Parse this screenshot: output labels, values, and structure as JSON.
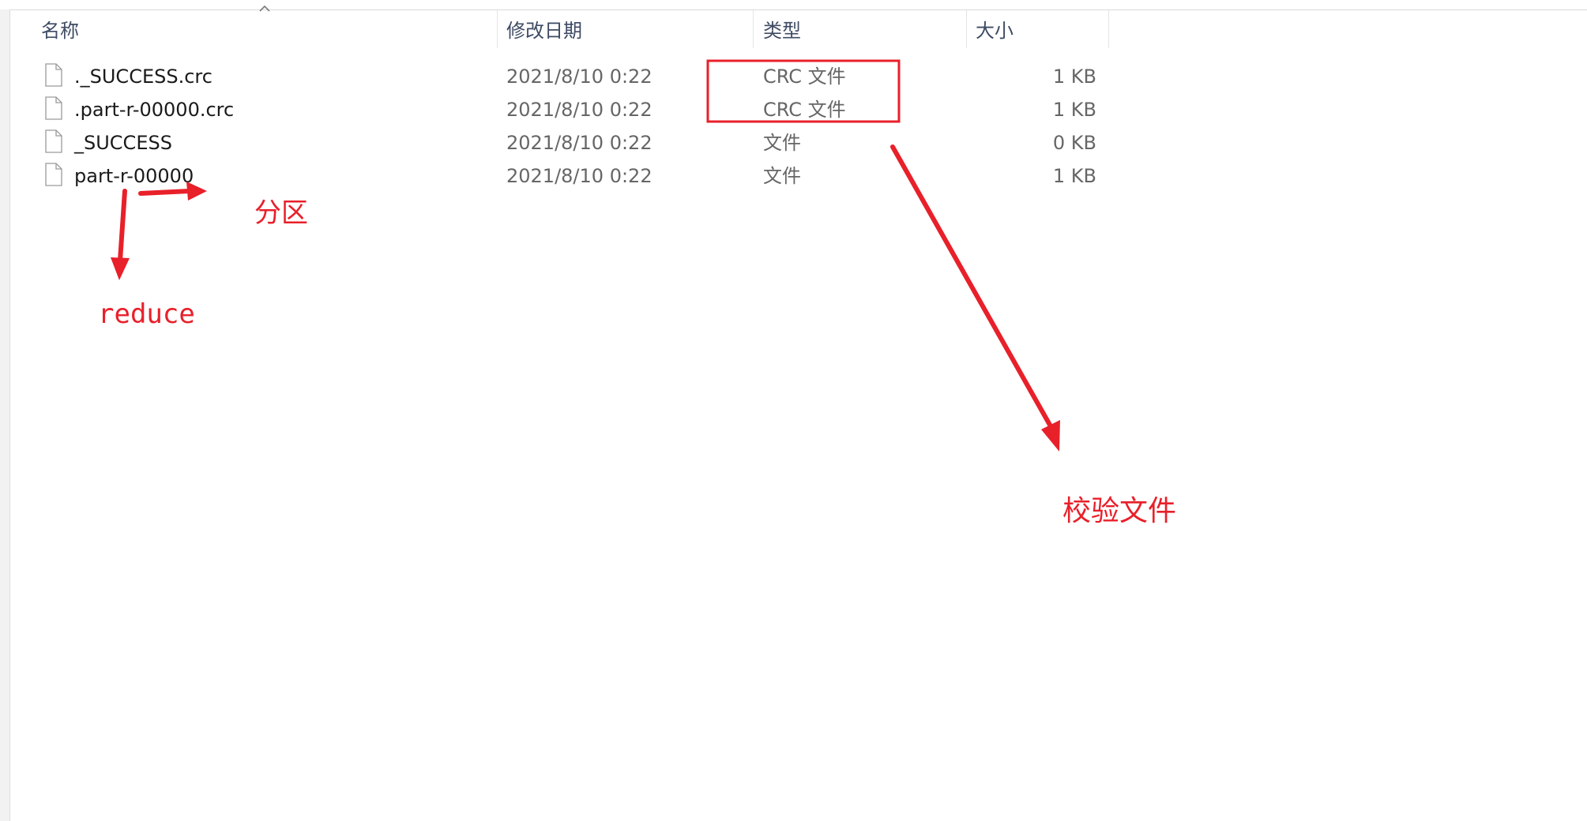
{
  "columns": {
    "name": "名称",
    "date": "修改日期",
    "type": "类型",
    "size": "大小"
  },
  "files": [
    {
      "name": "._SUCCESS.crc",
      "date": "2021/8/10 0:22",
      "type": "CRC 文件",
      "size": "1 KB",
      "icon": "file-icon"
    },
    {
      "name": ".part-r-00000.crc",
      "date": "2021/8/10 0:22",
      "type": "CRC 文件",
      "size": "1 KB",
      "icon": "file-icon"
    },
    {
      "name": "_SUCCESS",
      "date": "2021/8/10 0:22",
      "type": "文件",
      "size": "0 KB",
      "icon": "file-icon"
    },
    {
      "name": "part-r-00000",
      "date": "2021/8/10 0:22",
      "type": "文件",
      "size": "1 KB",
      "icon": "file-icon"
    }
  ],
  "annotations": {
    "partition_label": "分区",
    "reduce_label": "reduce",
    "checksum_label": "校验文件",
    "color": "#e8202a"
  },
  "sort": {
    "indicator_icon": "sort-caret-up-icon"
  }
}
